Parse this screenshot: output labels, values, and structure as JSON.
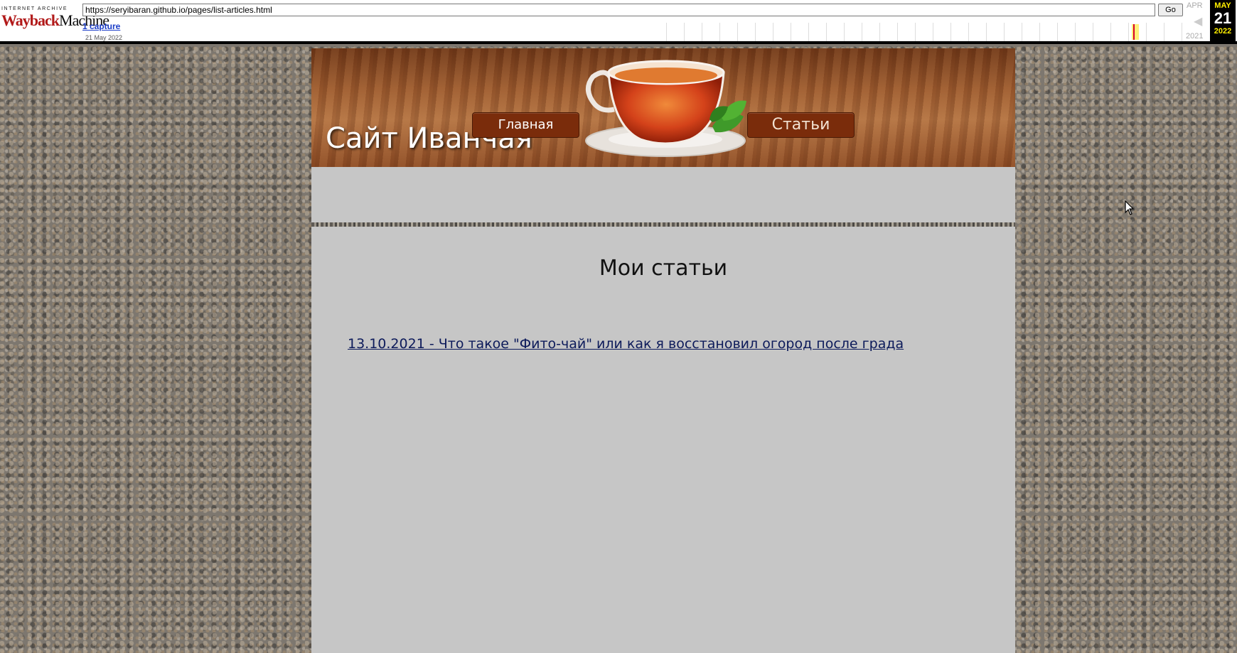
{
  "wayback": {
    "logo_top": "INTERNET ARCHIVE",
    "logo_wayback": "Wayback",
    "logo_machine": "Machine",
    "url": "https://seryibaran.github.io/pages/list-articles.html",
    "go_label": "Go",
    "captures_label": "1 capture",
    "capture_date": "21 May 2022",
    "prev_month": "APR",
    "prev_year": "2021",
    "current_month": "MAY",
    "current_day": "21",
    "current_year": "2022"
  },
  "site": {
    "title": "Сайт Иванчая"
  },
  "nav": {
    "home": "Главная",
    "articles": "Статьи"
  },
  "main": {
    "heading": "Мои статьи",
    "articles": [
      {
        "label": "13.10.2021 - Что такое \"Фито-чай\" или как я восстановил огород после града"
      }
    ]
  },
  "colors": {
    "button_bg": "#7a2c0b",
    "content_bg": "#c6c6c6",
    "link": "#0c1a5a"
  }
}
